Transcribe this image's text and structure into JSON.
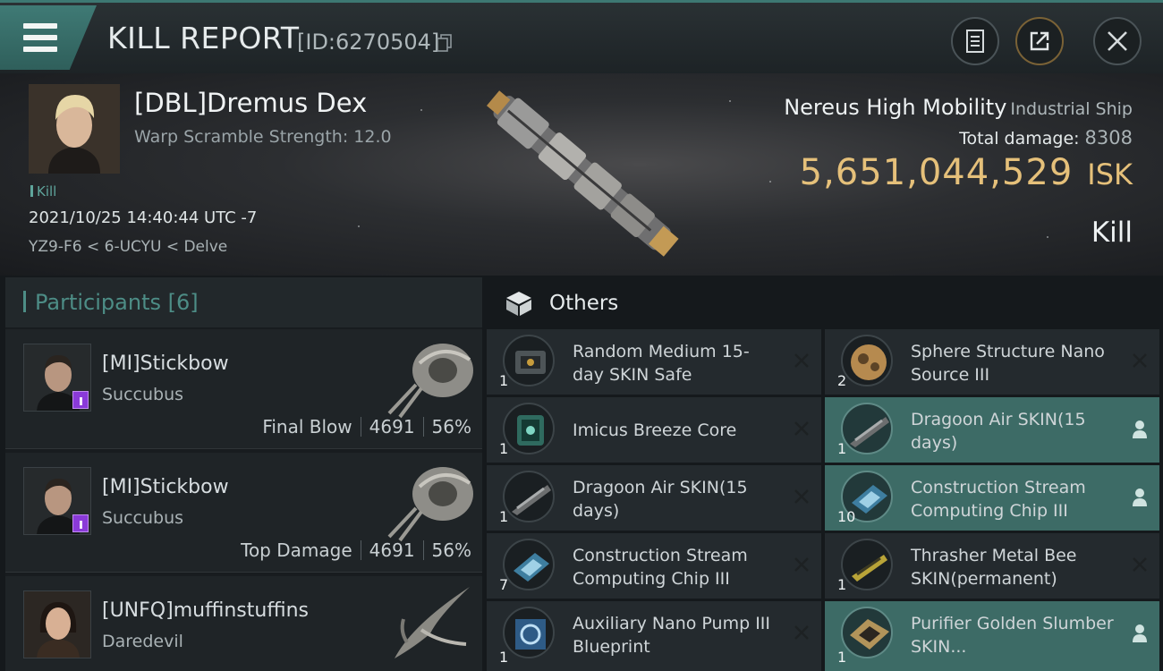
{
  "header": {
    "title": "KILL REPORT",
    "report_id": "[ID:6270504]",
    "accent": "#3d7873"
  },
  "victim": {
    "name": "[DBL]Dremus Dex",
    "warp_scramble": "Warp Scramble Strength: 12.0",
    "kill_tag": "Kill",
    "datetime": "2021/10/25 14:40:44 UTC -7",
    "location": "YZ9-F6 < 6-UCYU < Delve",
    "ship_name": "Nereus High Mobility",
    "ship_class": "Industrial Ship",
    "damage_label": "Total damage:",
    "damage_value": "8308",
    "isk_value": "5,651,044,529",
    "isk_unit": "ISK",
    "kill_type": "Kill",
    "isk_color": "#e5c07a"
  },
  "participants": {
    "label": "Participants",
    "count": "[6]",
    "rows": [
      {
        "name": "[MI]Stickbow",
        "ship": "Succubus",
        "role": "Final Blow",
        "damage": "4691",
        "percent": "56%"
      },
      {
        "name": "[MI]Stickbow",
        "ship": "Succubus",
        "role": "Top Damage",
        "damage": "4691",
        "percent": "56%"
      },
      {
        "name": "[UNFQ]muffinstuffins",
        "ship": "Daredevil"
      }
    ]
  },
  "others": {
    "title": "Others",
    "items": [
      {
        "name": "Random Medium 15-day SKIN Safe",
        "qty": "1",
        "icon": "skin-safe-icon",
        "status": "destroyed"
      },
      {
        "name": "Sphere Structure Nano Source III",
        "qty": "2",
        "icon": "sphere-structure-icon",
        "status": "destroyed"
      },
      {
        "name": "Imicus Breeze Core",
        "qty": "1",
        "icon": "breeze-core-icon",
        "status": "destroyed"
      },
      {
        "name": "Dragoon Air SKIN(15 days)",
        "qty": "1",
        "icon": "ship-skin-icon",
        "status": "dropped"
      },
      {
        "name": "Dragoon Air SKIN(15 days)",
        "qty": "1",
        "icon": "ship-skin-icon",
        "status": "destroyed"
      },
      {
        "name": "Construction Stream Computing Chip III",
        "qty": "10",
        "icon": "computing-chip-icon",
        "status": "dropped"
      },
      {
        "name": "Construction Stream Computing Chip III",
        "qty": "7",
        "icon": "computing-chip-icon",
        "status": "destroyed"
      },
      {
        "name": "Thrasher Metal Bee SKIN(permanent)",
        "qty": "1",
        "icon": "ship-skin-icon",
        "status": "destroyed"
      },
      {
        "name": "Auxiliary Nano Pump III Blueprint",
        "qty": "1",
        "icon": "blueprint-icon",
        "status": "destroyed"
      },
      {
        "name": "Purifier Golden Slumber SKIN...",
        "qty": "1",
        "icon": "ship-skin-icon",
        "status": "dropped"
      }
    ]
  }
}
